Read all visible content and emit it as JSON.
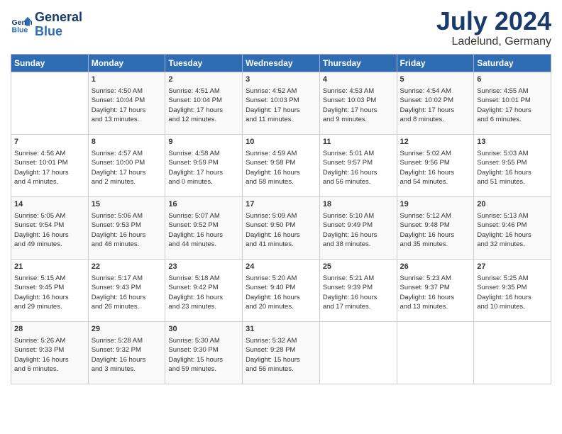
{
  "header": {
    "logo_line1": "General",
    "logo_line2": "Blue",
    "month": "July 2024",
    "location": "Ladelund, Germany"
  },
  "columns": [
    "Sunday",
    "Monday",
    "Tuesday",
    "Wednesday",
    "Thursday",
    "Friday",
    "Saturday"
  ],
  "weeks": [
    [
      {
        "day": "",
        "info": ""
      },
      {
        "day": "1",
        "info": "Sunrise: 4:50 AM\nSunset: 10:04 PM\nDaylight: 17 hours\nand 13 minutes."
      },
      {
        "day": "2",
        "info": "Sunrise: 4:51 AM\nSunset: 10:04 PM\nDaylight: 17 hours\nand 12 minutes."
      },
      {
        "day": "3",
        "info": "Sunrise: 4:52 AM\nSunset: 10:03 PM\nDaylight: 17 hours\nand 11 minutes."
      },
      {
        "day": "4",
        "info": "Sunrise: 4:53 AM\nSunset: 10:03 PM\nDaylight: 17 hours\nand 9 minutes."
      },
      {
        "day": "5",
        "info": "Sunrise: 4:54 AM\nSunset: 10:02 PM\nDaylight: 17 hours\nand 8 minutes."
      },
      {
        "day": "6",
        "info": "Sunrise: 4:55 AM\nSunset: 10:01 PM\nDaylight: 17 hours\nand 6 minutes."
      }
    ],
    [
      {
        "day": "7",
        "info": "Sunrise: 4:56 AM\nSunset: 10:01 PM\nDaylight: 17 hours\nand 4 minutes."
      },
      {
        "day": "8",
        "info": "Sunrise: 4:57 AM\nSunset: 10:00 PM\nDaylight: 17 hours\nand 2 minutes."
      },
      {
        "day": "9",
        "info": "Sunrise: 4:58 AM\nSunset: 9:59 PM\nDaylight: 17 hours\nand 0 minutes."
      },
      {
        "day": "10",
        "info": "Sunrise: 4:59 AM\nSunset: 9:58 PM\nDaylight: 16 hours\nand 58 minutes."
      },
      {
        "day": "11",
        "info": "Sunrise: 5:01 AM\nSunset: 9:57 PM\nDaylight: 16 hours\nand 56 minutes."
      },
      {
        "day": "12",
        "info": "Sunrise: 5:02 AM\nSunset: 9:56 PM\nDaylight: 16 hours\nand 54 minutes."
      },
      {
        "day": "13",
        "info": "Sunrise: 5:03 AM\nSunset: 9:55 PM\nDaylight: 16 hours\nand 51 minutes."
      }
    ],
    [
      {
        "day": "14",
        "info": "Sunrise: 5:05 AM\nSunset: 9:54 PM\nDaylight: 16 hours\nand 49 minutes."
      },
      {
        "day": "15",
        "info": "Sunrise: 5:06 AM\nSunset: 9:53 PM\nDaylight: 16 hours\nand 46 minutes."
      },
      {
        "day": "16",
        "info": "Sunrise: 5:07 AM\nSunset: 9:52 PM\nDaylight: 16 hours\nand 44 minutes."
      },
      {
        "day": "17",
        "info": "Sunrise: 5:09 AM\nSunset: 9:50 PM\nDaylight: 16 hours\nand 41 minutes."
      },
      {
        "day": "18",
        "info": "Sunrise: 5:10 AM\nSunset: 9:49 PM\nDaylight: 16 hours\nand 38 minutes."
      },
      {
        "day": "19",
        "info": "Sunrise: 5:12 AM\nSunset: 9:48 PM\nDaylight: 16 hours\nand 35 minutes."
      },
      {
        "day": "20",
        "info": "Sunrise: 5:13 AM\nSunset: 9:46 PM\nDaylight: 16 hours\nand 32 minutes."
      }
    ],
    [
      {
        "day": "21",
        "info": "Sunrise: 5:15 AM\nSunset: 9:45 PM\nDaylight: 16 hours\nand 29 minutes."
      },
      {
        "day": "22",
        "info": "Sunrise: 5:17 AM\nSunset: 9:43 PM\nDaylight: 16 hours\nand 26 minutes."
      },
      {
        "day": "23",
        "info": "Sunrise: 5:18 AM\nSunset: 9:42 PM\nDaylight: 16 hours\nand 23 minutes."
      },
      {
        "day": "24",
        "info": "Sunrise: 5:20 AM\nSunset: 9:40 PM\nDaylight: 16 hours\nand 20 minutes."
      },
      {
        "day": "25",
        "info": "Sunrise: 5:21 AM\nSunset: 9:39 PM\nDaylight: 16 hours\nand 17 minutes."
      },
      {
        "day": "26",
        "info": "Sunrise: 5:23 AM\nSunset: 9:37 PM\nDaylight: 16 hours\nand 13 minutes."
      },
      {
        "day": "27",
        "info": "Sunrise: 5:25 AM\nSunset: 9:35 PM\nDaylight: 16 hours\nand 10 minutes."
      }
    ],
    [
      {
        "day": "28",
        "info": "Sunrise: 5:26 AM\nSunset: 9:33 PM\nDaylight: 16 hours\nand 6 minutes."
      },
      {
        "day": "29",
        "info": "Sunrise: 5:28 AM\nSunset: 9:32 PM\nDaylight: 16 hours\nand 3 minutes."
      },
      {
        "day": "30",
        "info": "Sunrise: 5:30 AM\nSunset: 9:30 PM\nDaylight: 15 hours\nand 59 minutes."
      },
      {
        "day": "31",
        "info": "Sunrise: 5:32 AM\nSunset: 9:28 PM\nDaylight: 15 hours\nand 56 minutes."
      },
      {
        "day": "",
        "info": ""
      },
      {
        "day": "",
        "info": ""
      },
      {
        "day": "",
        "info": ""
      }
    ]
  ]
}
